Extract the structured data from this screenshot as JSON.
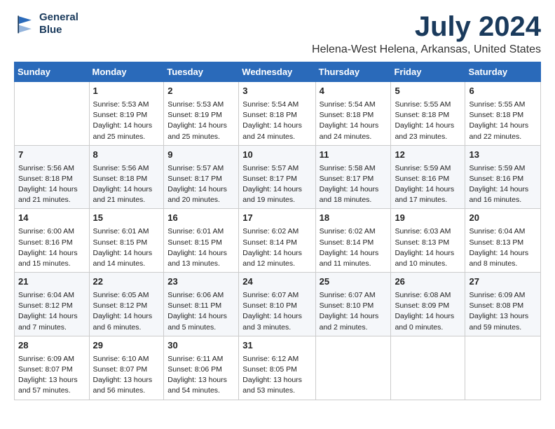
{
  "logo": {
    "line1": "General",
    "line2": "Blue"
  },
  "title": "July 2024",
  "location": "Helena-West Helena, Arkansas, United States",
  "days_of_week": [
    "Sunday",
    "Monday",
    "Tuesday",
    "Wednesday",
    "Thursday",
    "Friday",
    "Saturday"
  ],
  "weeks": [
    [
      {
        "day": "",
        "content": ""
      },
      {
        "day": "1",
        "content": "Sunrise: 5:53 AM\nSunset: 8:19 PM\nDaylight: 14 hours\nand 25 minutes."
      },
      {
        "day": "2",
        "content": "Sunrise: 5:53 AM\nSunset: 8:19 PM\nDaylight: 14 hours\nand 25 minutes."
      },
      {
        "day": "3",
        "content": "Sunrise: 5:54 AM\nSunset: 8:18 PM\nDaylight: 14 hours\nand 24 minutes."
      },
      {
        "day": "4",
        "content": "Sunrise: 5:54 AM\nSunset: 8:18 PM\nDaylight: 14 hours\nand 24 minutes."
      },
      {
        "day": "5",
        "content": "Sunrise: 5:55 AM\nSunset: 8:18 PM\nDaylight: 14 hours\nand 23 minutes."
      },
      {
        "day": "6",
        "content": "Sunrise: 5:55 AM\nSunset: 8:18 PM\nDaylight: 14 hours\nand 22 minutes."
      }
    ],
    [
      {
        "day": "7",
        "content": "Sunrise: 5:56 AM\nSunset: 8:18 PM\nDaylight: 14 hours\nand 21 minutes."
      },
      {
        "day": "8",
        "content": "Sunrise: 5:56 AM\nSunset: 8:18 PM\nDaylight: 14 hours\nand 21 minutes."
      },
      {
        "day": "9",
        "content": "Sunrise: 5:57 AM\nSunset: 8:17 PM\nDaylight: 14 hours\nand 20 minutes."
      },
      {
        "day": "10",
        "content": "Sunrise: 5:57 AM\nSunset: 8:17 PM\nDaylight: 14 hours\nand 19 minutes."
      },
      {
        "day": "11",
        "content": "Sunrise: 5:58 AM\nSunset: 8:17 PM\nDaylight: 14 hours\nand 18 minutes."
      },
      {
        "day": "12",
        "content": "Sunrise: 5:59 AM\nSunset: 8:16 PM\nDaylight: 14 hours\nand 17 minutes."
      },
      {
        "day": "13",
        "content": "Sunrise: 5:59 AM\nSunset: 8:16 PM\nDaylight: 14 hours\nand 16 minutes."
      }
    ],
    [
      {
        "day": "14",
        "content": "Sunrise: 6:00 AM\nSunset: 8:16 PM\nDaylight: 14 hours\nand 15 minutes."
      },
      {
        "day": "15",
        "content": "Sunrise: 6:01 AM\nSunset: 8:15 PM\nDaylight: 14 hours\nand 14 minutes."
      },
      {
        "day": "16",
        "content": "Sunrise: 6:01 AM\nSunset: 8:15 PM\nDaylight: 14 hours\nand 13 minutes."
      },
      {
        "day": "17",
        "content": "Sunrise: 6:02 AM\nSunset: 8:14 PM\nDaylight: 14 hours\nand 12 minutes."
      },
      {
        "day": "18",
        "content": "Sunrise: 6:02 AM\nSunset: 8:14 PM\nDaylight: 14 hours\nand 11 minutes."
      },
      {
        "day": "19",
        "content": "Sunrise: 6:03 AM\nSunset: 8:13 PM\nDaylight: 14 hours\nand 10 minutes."
      },
      {
        "day": "20",
        "content": "Sunrise: 6:04 AM\nSunset: 8:13 PM\nDaylight: 14 hours\nand 8 minutes."
      }
    ],
    [
      {
        "day": "21",
        "content": "Sunrise: 6:04 AM\nSunset: 8:12 PM\nDaylight: 14 hours\nand 7 minutes."
      },
      {
        "day": "22",
        "content": "Sunrise: 6:05 AM\nSunset: 8:12 PM\nDaylight: 14 hours\nand 6 minutes."
      },
      {
        "day": "23",
        "content": "Sunrise: 6:06 AM\nSunset: 8:11 PM\nDaylight: 14 hours\nand 5 minutes."
      },
      {
        "day": "24",
        "content": "Sunrise: 6:07 AM\nSunset: 8:10 PM\nDaylight: 14 hours\nand 3 minutes."
      },
      {
        "day": "25",
        "content": "Sunrise: 6:07 AM\nSunset: 8:10 PM\nDaylight: 14 hours\nand 2 minutes."
      },
      {
        "day": "26",
        "content": "Sunrise: 6:08 AM\nSunset: 8:09 PM\nDaylight: 14 hours\nand 0 minutes."
      },
      {
        "day": "27",
        "content": "Sunrise: 6:09 AM\nSunset: 8:08 PM\nDaylight: 13 hours\nand 59 minutes."
      }
    ],
    [
      {
        "day": "28",
        "content": "Sunrise: 6:09 AM\nSunset: 8:07 PM\nDaylight: 13 hours\nand 57 minutes."
      },
      {
        "day": "29",
        "content": "Sunrise: 6:10 AM\nSunset: 8:07 PM\nDaylight: 13 hours\nand 56 minutes."
      },
      {
        "day": "30",
        "content": "Sunrise: 6:11 AM\nSunset: 8:06 PM\nDaylight: 13 hours\nand 54 minutes."
      },
      {
        "day": "31",
        "content": "Sunrise: 6:12 AM\nSunset: 8:05 PM\nDaylight: 13 hours\nand 53 minutes."
      },
      {
        "day": "",
        "content": ""
      },
      {
        "day": "",
        "content": ""
      },
      {
        "day": "",
        "content": ""
      }
    ]
  ]
}
